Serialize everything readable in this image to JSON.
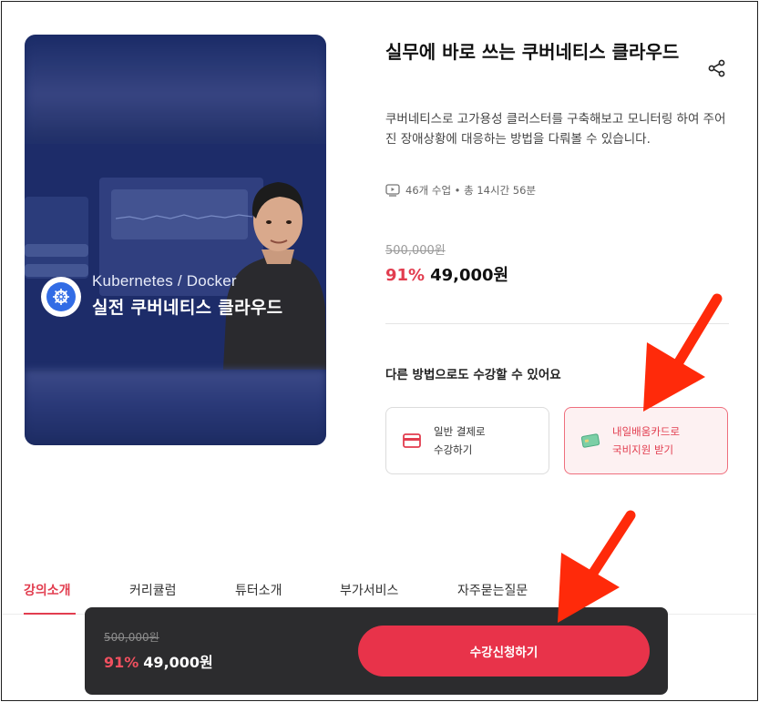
{
  "course": {
    "title": "실무에 바로 쓰는 쿠버네티스 클라우드",
    "description": "쿠버네티스로 고가용성 클러스터를 구축해보고 모니터링 하여 주어진 장애상황에 대응하는 방법을 다뤄볼 수 있습니다.",
    "meta": "46개 수업 • 총 14시간 56분",
    "original_price": "500,000원",
    "discount": "91%",
    "price": "49,000원"
  },
  "thumbnail": {
    "subtitle": "Kubernetes / Docker",
    "title": "실전 쿠버네티스 클라우드",
    "logo_icon": "kubernetes-logo"
  },
  "payment_options": {
    "heading": "다른 방법으로도 수강할 수 있어요",
    "options": [
      {
        "icon": "credit-card-icon",
        "line1": "일반 결제로",
        "line2": "수강하기"
      },
      {
        "icon": "green-card-icon",
        "line1": "내일배움카드로",
        "line2": "국비지원 받기"
      }
    ]
  },
  "tabs": [
    {
      "label": "강의소개",
      "active": true
    },
    {
      "label": "커리큘럼",
      "active": false
    },
    {
      "label": "튜터소개",
      "active": false
    },
    {
      "label": "부가서비스",
      "active": false
    },
    {
      "label": "자주묻는질문",
      "active": false
    }
  ],
  "bottom_bar": {
    "original_price": "500,000원",
    "discount": "91%",
    "price": "49,000원",
    "cta": "수강신청하기"
  },
  "colors": {
    "accent": "#e8334a",
    "annotation_arrow": "#ff2a0a",
    "thumbnail_bg": "#1d2c69",
    "bar_bg": "#2c2c2e"
  }
}
